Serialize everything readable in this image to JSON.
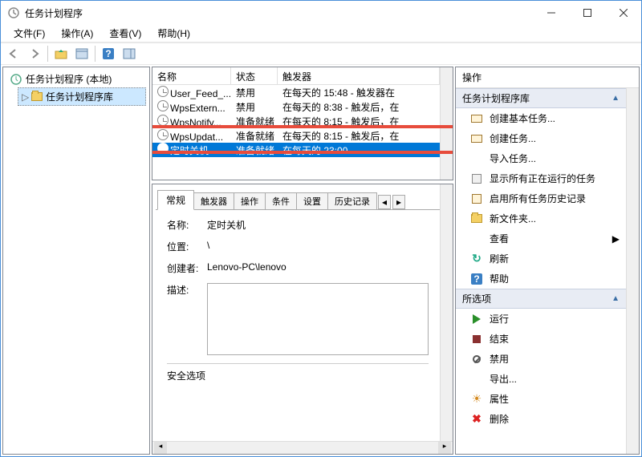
{
  "window": {
    "title": "任务计划程序"
  },
  "menu": {
    "file": "文件(F)",
    "action": "操作(A)",
    "view": "查看(V)",
    "help": "帮助(H)"
  },
  "tree": {
    "root": "任务计划程序 (本地)",
    "child": "任务计划程序库"
  },
  "task_list": {
    "headers": {
      "name": "名称",
      "state": "状态",
      "trigger": "触发器"
    },
    "rows": [
      {
        "name": "User_Feed_...",
        "state": "禁用",
        "trigger": "在每天的 15:48 - 触发器在"
      },
      {
        "name": "WpsExtern...",
        "state": "禁用",
        "trigger": "在每天的 8:38 - 触发后，在"
      },
      {
        "name": "WpsNotify...",
        "state": "准备就绪",
        "trigger": "在每天的 8:15 - 触发后，在"
      },
      {
        "name": "WpsUpdat...",
        "state": "准备就绪",
        "trigger": "在每天的 8:15 - 触发后，在"
      },
      {
        "name": "定时关机",
        "state": "准备就绪",
        "trigger": "在每天的 23:00"
      }
    ]
  },
  "detail": {
    "tabs": {
      "general": "常规",
      "triggers": "触发器",
      "actions": "操作",
      "conditions": "条件",
      "settings": "设置",
      "history": "历史记录"
    },
    "name_label": "名称:",
    "name_value": "定时关机",
    "location_label": "位置:",
    "location_value": "\\",
    "creator_label": "创建者:",
    "creator_value": "Lenovo-PC\\lenovo",
    "desc_label": "描述:",
    "security_header": "安全选项"
  },
  "actions": {
    "panel_title": "操作",
    "group1": "任务计划程序库",
    "create_basic": "创建基本任务...",
    "create_task": "创建任务...",
    "import": "导入任务...",
    "show_running": "显示所有正在运行的任务",
    "enable_history": "启用所有任务历史记录",
    "new_folder": "新文件夹...",
    "view": "查看",
    "refresh": "刷新",
    "help": "帮助",
    "group2": "所选项",
    "run": "运行",
    "end": "结束",
    "disable": "禁用",
    "export": "导出...",
    "properties": "属性",
    "delete": "删除"
  }
}
